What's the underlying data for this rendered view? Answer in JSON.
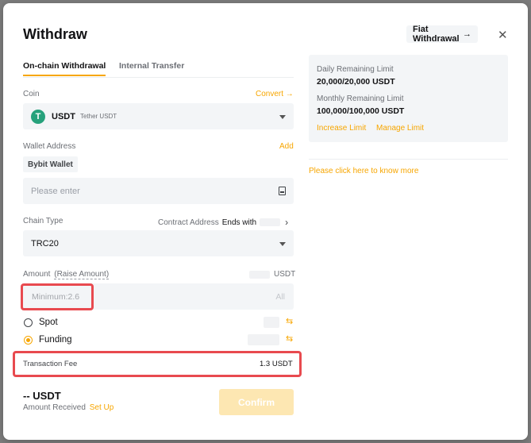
{
  "dialog": {
    "title": "Withdraw",
    "fiat_button": "Fiat Withdrawal",
    "close_icon": "close-icon"
  },
  "tabs": [
    {
      "label": "On-chain Withdrawal",
      "active": true
    },
    {
      "label": "Internal Transfer",
      "active": false
    }
  ],
  "coin": {
    "label": "Coin",
    "convert_link": "Convert",
    "symbol": "USDT",
    "name": "Tether USDT",
    "icon_letter": "T",
    "icon_color": "#26a17b"
  },
  "wallet": {
    "label": "Wallet Address",
    "add_link": "Add",
    "chip": "Bybit Wallet",
    "placeholder": "Please enter"
  },
  "chain": {
    "label": "Chain Type",
    "contract_label": "Contract Address",
    "ends_with": "Ends with",
    "value": "TRC20"
  },
  "amount": {
    "label": "Amount",
    "raise_link": "(Raise Amount)",
    "unit": "USDT",
    "placeholder": "Minimum:2.6",
    "all": "All"
  },
  "accounts": [
    {
      "label": "Spot",
      "selected": false
    },
    {
      "label": "Funding",
      "selected": true
    }
  ],
  "fee": {
    "label": "Transaction Fee",
    "value": "1.3 USDT"
  },
  "receive": {
    "value": "-- USDT",
    "label": "Amount Received",
    "setup_link": "Set Up"
  },
  "confirm_button": "Confirm",
  "limits": {
    "daily_label": "Daily Remaining Limit",
    "daily_value": "20,000/20,000 USDT",
    "monthly_label": "Monthly Remaining Limit",
    "monthly_value": "100,000/100,000 USDT",
    "increase_link": "Increase Limit",
    "manage_link": "Manage Limit"
  },
  "help_link": "Please click here to know more",
  "colors": {
    "accent": "#f7a600",
    "highlight": "#e84a4f",
    "field_bg": "#f3f5f7"
  }
}
